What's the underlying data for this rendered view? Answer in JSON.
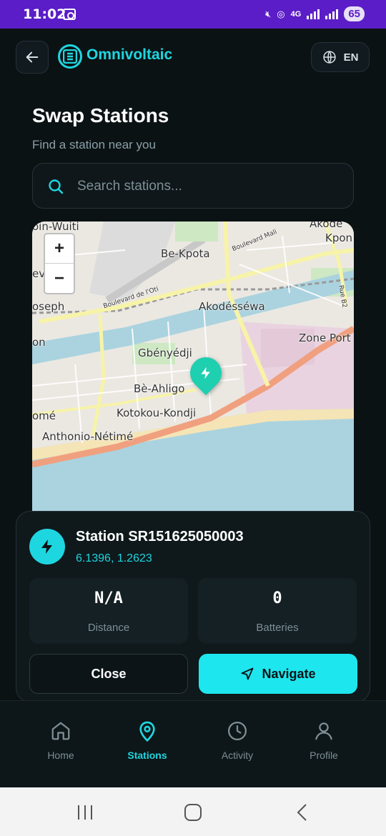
{
  "status_bar": {
    "time": "11:02",
    "network": "4G",
    "battery": "65"
  },
  "header": {
    "back_icon": "arrow-left-icon",
    "brand": "Omnivoltaic",
    "language": "EN",
    "language_icon": "globe-icon"
  },
  "page": {
    "title": "Swap Stations",
    "subtitle": "Find a station near you"
  },
  "search": {
    "placeholder": "Search stations...",
    "value": ""
  },
  "map": {
    "zoom_in": "+",
    "zoom_out": "−",
    "labels": [
      "Be-Kpota",
      "Akodésséwa",
      "Gbényédji",
      "Bè-Ahligo",
      "Kotokou-Kondji",
      "Anthonio-Nétimé",
      "Zone Port",
      "Kpon",
      "Akode",
      "oin-Wuiti",
      "oseph",
      "ev",
      "on",
      "omé",
      "Boulevard de l'Oti",
      "Boulevard Mali",
      "Rue B2"
    ],
    "marker_icon": "bolt-icon"
  },
  "station_card": {
    "name": "Station SR151625050003",
    "coordinates": "6.1396, 1.2623",
    "distance_value": "N/A",
    "distance_label": "Distance",
    "batteries_value": "0",
    "batteries_label": "Batteries",
    "close_label": "Close",
    "navigate_label": "Navigate"
  },
  "bottom_nav": [
    {
      "label": "Home",
      "icon": "home-icon",
      "active": false
    },
    {
      "label": "Stations",
      "icon": "map-pin-icon",
      "active": true
    },
    {
      "label": "Activity",
      "icon": "clock-icon",
      "active": false
    },
    {
      "label": "Profile",
      "icon": "user-icon",
      "active": false
    }
  ],
  "colors": {
    "accent": "#1ed6e0",
    "background": "#0b1214",
    "status_bar": "#5b1dc7"
  }
}
